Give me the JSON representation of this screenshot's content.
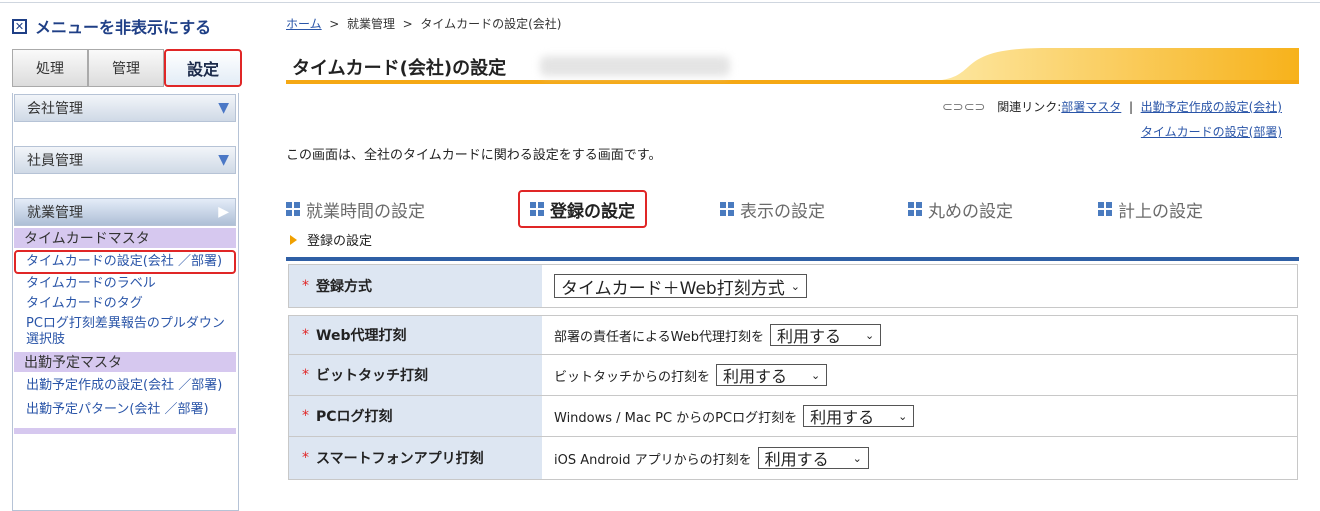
{
  "sidebar": {
    "toggle_label": "メニューを非表示にする",
    "tabs": [
      "処理",
      "管理",
      "設定"
    ],
    "sections": [
      {
        "label": "会社管理"
      },
      {
        "label": "社員管理"
      },
      {
        "label": "就業管理"
      }
    ],
    "groups": [
      {
        "header": "タイムカードマスタ",
        "links": [
          "タイムカードの設定(会社 ／部署)",
          "タイムカードのラベル",
          "タイムカードのタグ",
          "PCログ打刻差異報告のプルダウン選択肢"
        ]
      },
      {
        "header": "出勤予定マスタ",
        "links": [
          "出勤予定作成の設定(会社 ／部署)",
          "出勤予定パターン(会社 ／部署)"
        ]
      }
    ]
  },
  "breadcrumb": {
    "home": "ホーム",
    "sep": ">",
    "level2": "就業管理",
    "current": "タイムカードの設定(会社)"
  },
  "page": {
    "title": "タイムカード(会社)の設定",
    "related_prefix": "関連リンク:",
    "related_links": [
      "部署マスタ",
      "出勤予定作成の設定(会社)",
      "タイムカードの設定(部署)"
    ],
    "description": "この画面は、全社のタイムカードに関わる設定をする画面です。",
    "tabs": [
      "就業時間の設定",
      "登録の設定",
      "表示の設定",
      "丸めの設定",
      "計上の設定"
    ],
    "active_tab_index": 1,
    "subsection": "登録の設定"
  },
  "form": {
    "required_mark": "*",
    "rows": [
      {
        "label": "登録方式",
        "text": "",
        "select": "タイムカード＋Web打刻方式"
      },
      {
        "label": "Web代理打刻",
        "text": "部署の責任者によるWeb代理打刻を",
        "select": "利用する"
      },
      {
        "label": "ビットタッチ打刻",
        "text": "ビットタッチからの打刻を",
        "select": "利用する"
      },
      {
        "label": "PCログ打刻",
        "text": "Windows / Mac PC からのPCログ打刻を",
        "select": "利用する"
      },
      {
        "label": "スマートフォンアプリ打刻",
        "text": "iOS Android アプリからの打刻を",
        "select": "利用する"
      }
    ]
  },
  "colors": {
    "accent_red": "#e02626",
    "link_blue": "#2a55a8",
    "title_gold": "#f7b21b",
    "nav_blue": "#2f5fa5"
  }
}
